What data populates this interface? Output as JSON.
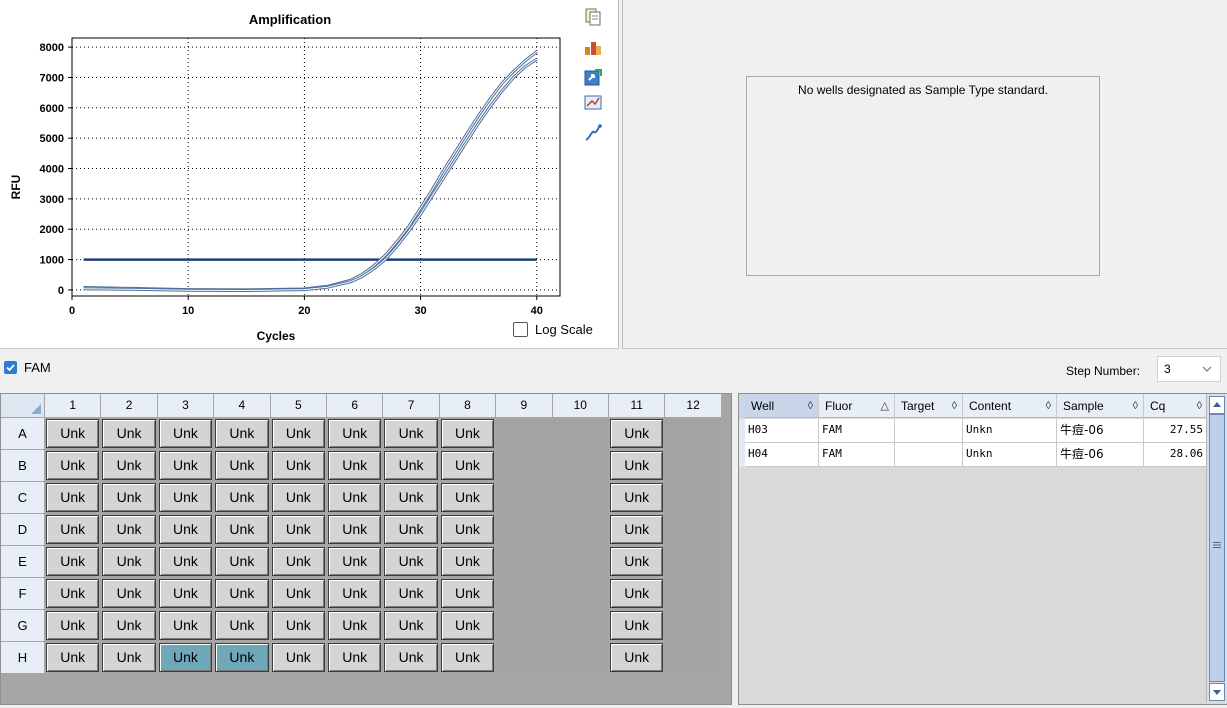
{
  "chart": {
    "title": "Amplification",
    "xlabel": "Cycles",
    "ylabel": "RFU",
    "log_scale_label": "Log Scale",
    "log_scale_checked": false
  },
  "chart_data": {
    "type": "line",
    "title": "Amplification",
    "xlabel": "Cycles",
    "ylabel": "RFU",
    "xlim": [
      0,
      42
    ],
    "ylim": [
      -200,
      8300
    ],
    "x_ticks": [
      0,
      10,
      20,
      30,
      40
    ],
    "y_ticks": [
      0,
      1000,
      2000,
      3000,
      4000,
      5000,
      6000,
      7000,
      8000
    ],
    "grid": true,
    "threshold": 1000,
    "series": [
      {
        "x": [
          1,
          5,
          10,
          15,
          20,
          22,
          24,
          25,
          26,
          27,
          28,
          29,
          30,
          31,
          32,
          33,
          34,
          35,
          36,
          37,
          38,
          39,
          40
        ],
        "values": [
          80,
          50,
          10,
          0,
          30,
          120,
          320,
          520,
          800,
          1150,
          1600,
          2100,
          2700,
          3300,
          3950,
          4550,
          5150,
          5750,
          6300,
          6800,
          7200,
          7550,
          7850
        ]
      },
      {
        "x": [
          1,
          5,
          10,
          15,
          20,
          22,
          24,
          25,
          26,
          27,
          28,
          29,
          30,
          31,
          32,
          33,
          34,
          35,
          36,
          37,
          38,
          39,
          40
        ],
        "values": [
          40,
          20,
          -10,
          -20,
          10,
          90,
          270,
          450,
          700,
          1020,
          1450,
          1950,
          2500,
          3100,
          3700,
          4300,
          4900,
          5500,
          6050,
          6550,
          7000,
          7350,
          7600
        ]
      }
    ]
  },
  "standard_curve": {
    "message": "No wells designated as Sample Type standard."
  },
  "fluor": {
    "label": "FAM",
    "checked": true
  },
  "step": {
    "label": "Step Number:",
    "value": "3"
  },
  "plate": {
    "columns": [
      "1",
      "2",
      "3",
      "4",
      "5",
      "6",
      "7",
      "8",
      "9",
      "10",
      "11",
      "12"
    ],
    "rows": [
      "A",
      "B",
      "C",
      "D",
      "E",
      "F",
      "G",
      "H"
    ],
    "well_label": "Unk",
    "filled_columns": [
      1,
      2,
      3,
      4,
      5,
      6,
      7,
      8,
      11
    ],
    "selected_wells": [
      "H3",
      "H4"
    ]
  },
  "results": {
    "headers": [
      "Well",
      "Fluor",
      "Target",
      "Content",
      "Sample",
      "Cq"
    ],
    "rows": [
      {
        "well": "H03",
        "fluor": "FAM",
        "target": "",
        "content": "Unkn",
        "sample": "牛痘-06",
        "cq": "27.55"
      },
      {
        "well": "H04",
        "fluor": "FAM",
        "target": "",
        "content": "Unkn",
        "sample": "牛痘-06",
        "cq": "28.06"
      }
    ]
  },
  "colors": {
    "curve": "#4a6e9a",
    "threshold": "#1f3f77",
    "selected_well": "#6ea8b8",
    "checkbox": "#2f7ad0"
  }
}
